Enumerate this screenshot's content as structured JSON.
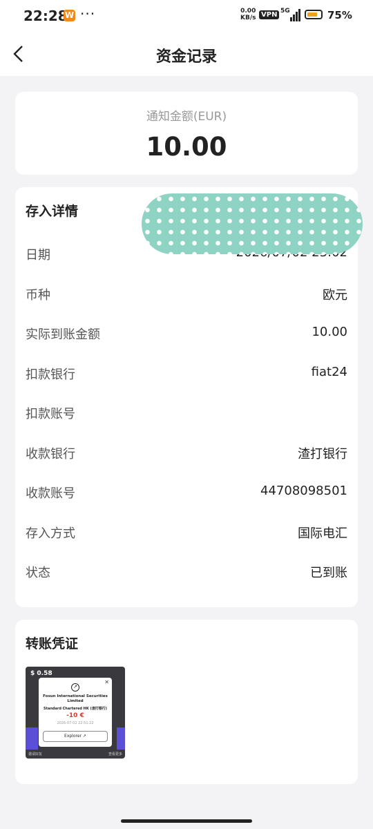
{
  "status_bar": {
    "time": "22:28",
    "app_badge": "W",
    "more": "···",
    "net_speed_value": "0.00",
    "net_speed_unit": "KB/s",
    "vpn": "VPN",
    "network": "5G",
    "battery_percent": "75%",
    "battery_level": 0.75,
    "battery_color": "#f0a020"
  },
  "nav": {
    "back_icon": "chevron-left-icon",
    "title": "资金记录"
  },
  "amount_card": {
    "label": "通知金额(EUR)",
    "value": "10.00"
  },
  "details": {
    "title": "存入详情",
    "rows": [
      {
        "key": "日期",
        "value": "2026/07/02  23:02"
      },
      {
        "key": "币种",
        "value": "欧元"
      },
      {
        "key": "实际到账金额",
        "value": "10.00"
      },
      {
        "key": "扣款银行",
        "value": "fiat24"
      },
      {
        "key": "扣款账号",
        "value": ""
      },
      {
        "key": "收款银行",
        "value": "渣打银行"
      },
      {
        "key": "收款账号",
        "value": "44708098501"
      },
      {
        "key": "存入方式",
        "value": "国际电汇"
      },
      {
        "key": "状态",
        "value": "已到账"
      }
    ]
  },
  "voucher": {
    "title": "转账凭证",
    "thumbnail": {
      "balance": "$ 0.58",
      "popup_name": "Fosun International Securities Limited",
      "popup_bank": "Standard Chartered HK (渣打银行)",
      "popup_amount": "-10 €",
      "popup_time": "2026-07-02 22:51:22",
      "popup_button": "Explorer ↗",
      "footer_left": "邀请好友",
      "footer_right": "查看更多"
    }
  },
  "colors": {
    "mask": "#8fd3c4",
    "negative_amount": "#e0332a",
    "page_bg": "#f3f3f5"
  }
}
